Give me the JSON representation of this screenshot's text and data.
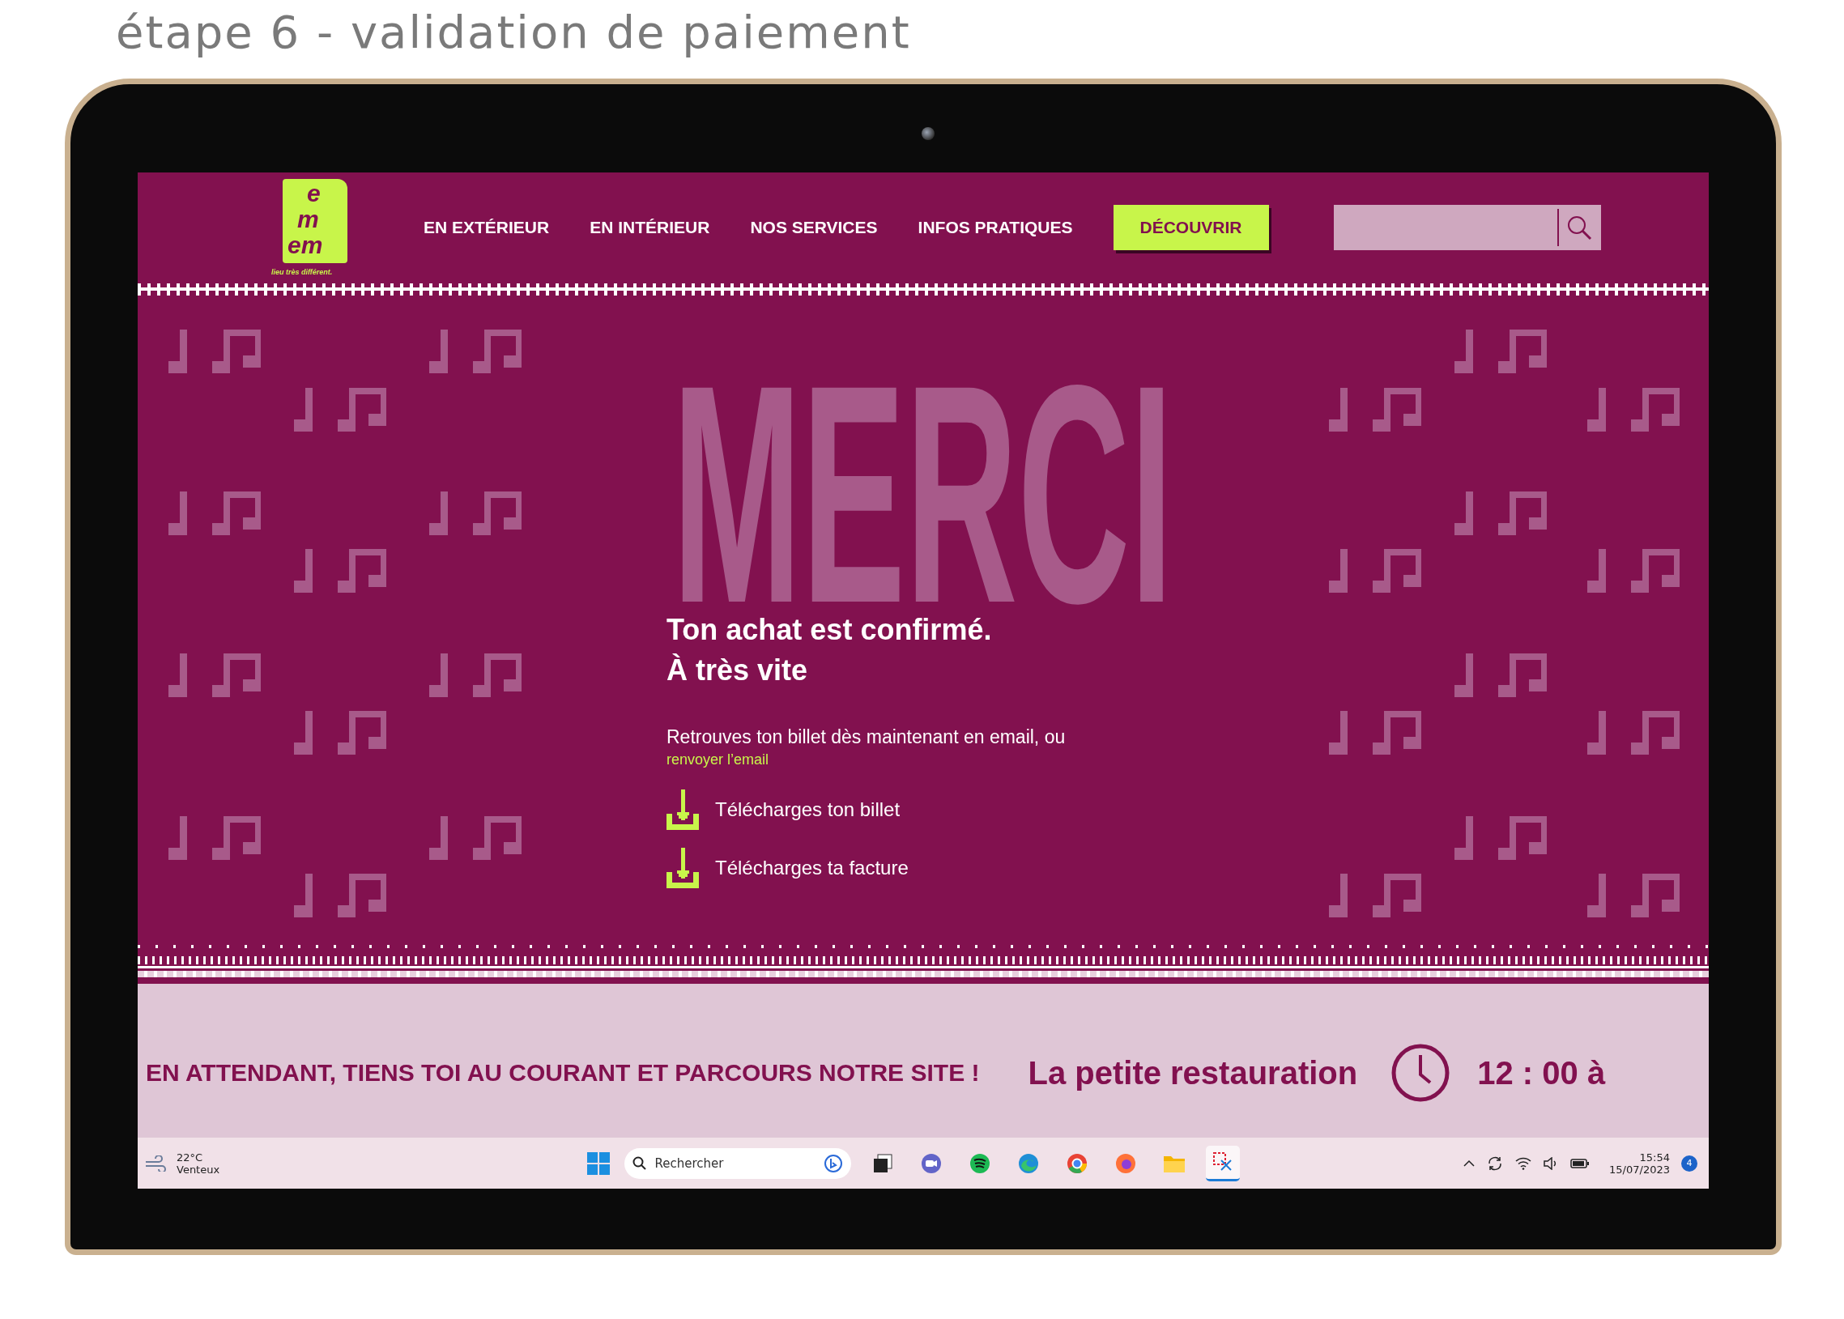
{
  "caption": "étape 6 - validation de paiement",
  "logo": {
    "lines": [
      "e",
      "m",
      "em"
    ],
    "tagline": "lieu très différent."
  },
  "nav": {
    "items": [
      "EN EXTÉRIEUR",
      "EN INTÉRIEUR",
      "NOS SERVICES",
      "INFOS PRATIQUES"
    ],
    "cta": "DÉCOUVRIR"
  },
  "hero": {
    "word": "MERCI",
    "heading": [
      "Ton achat est confirmé.",
      "À très vite"
    ],
    "message": "Retrouves ton billet dès maintenant en email, ou",
    "link": "renvoyer l’email",
    "downloads": [
      "Télécharges ton billet",
      "Télécharges ta facture"
    ]
  },
  "banner": {
    "headline": "EN ATTENDANT, TIENS TOI AU COURANT ET PARCOURS NOTRE SITE !",
    "venue": "La petite restauration",
    "time": "12 : 00 à"
  },
  "taskbar": {
    "weather": {
      "temp": "22°C",
      "condition": "Venteux"
    },
    "search_placeholder": "Rechercher",
    "apps": [
      {
        "kind": "taskview",
        "selected": false
      },
      {
        "kind": "chat",
        "selected": false
      },
      {
        "kind": "music",
        "selected": false
      },
      {
        "kind": "edge",
        "selected": false
      },
      {
        "kind": "chrome",
        "selected": false
      },
      {
        "kind": "firefox",
        "selected": false
      },
      {
        "kind": "folder",
        "selected": false
      },
      {
        "kind": "snip",
        "selected": true
      }
    ],
    "time": "15:54",
    "date": "15/07/2023",
    "notifications": "4"
  }
}
